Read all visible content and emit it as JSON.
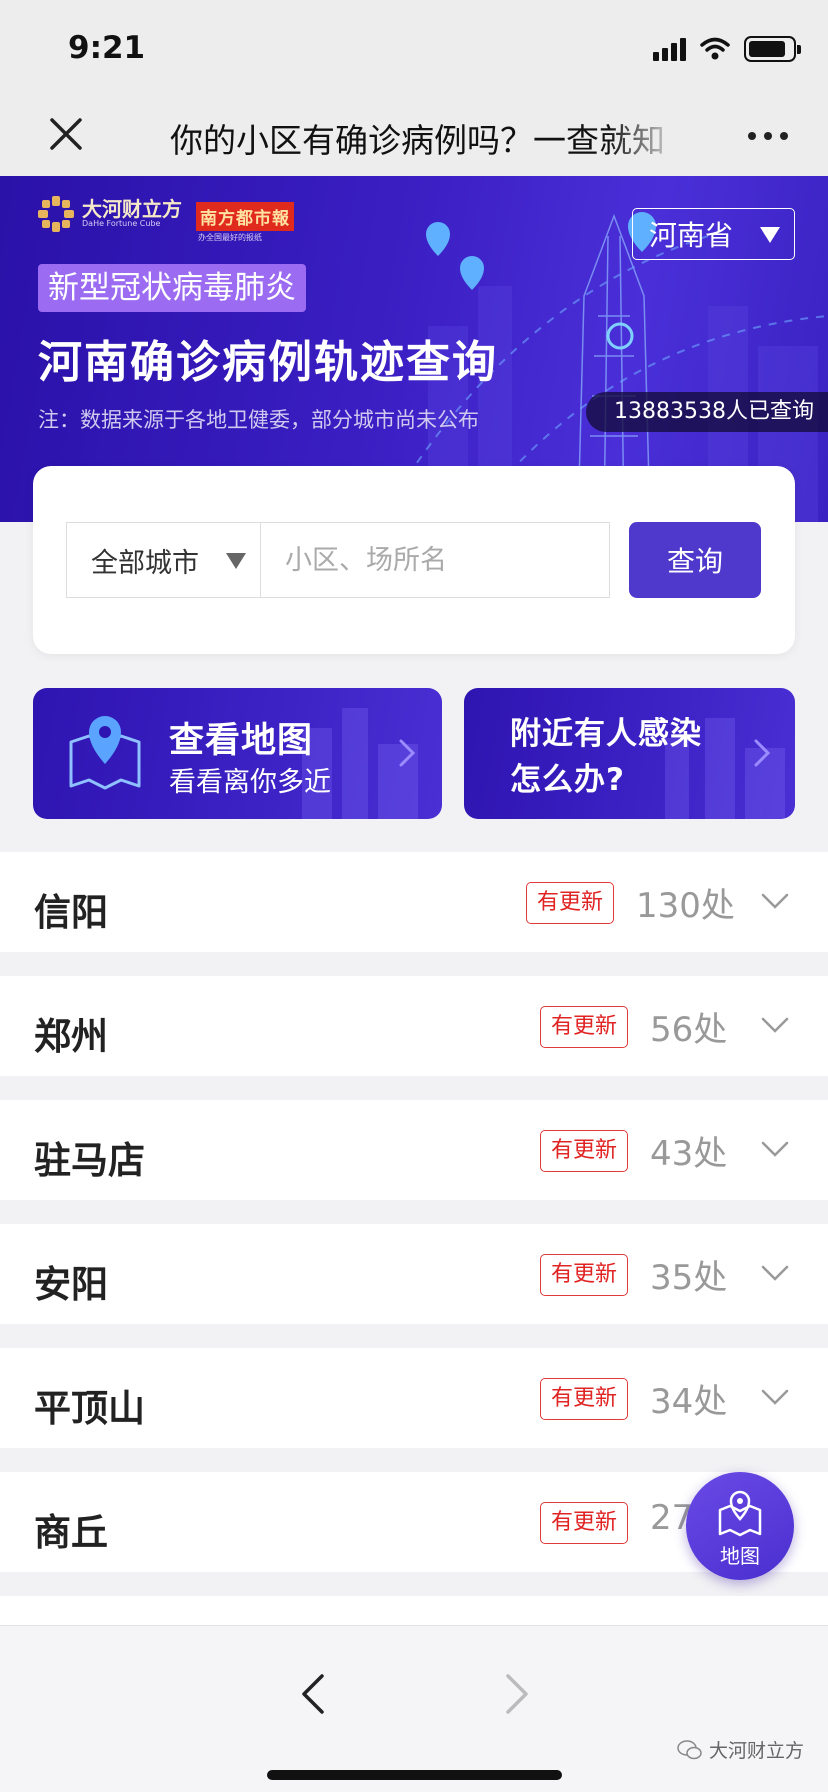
{
  "status_bar": {
    "time": "9:21",
    "battery_level": 0.85
  },
  "nav": {
    "title": "你的小区有确诊病例吗？一查就知"
  },
  "banner": {
    "brand_name": "大河财立方",
    "brand_sub": "DaHe Fortune Cube",
    "paper_name": "南方都市報",
    "paper_sub": "办全国最好的报纸",
    "province": "河南省",
    "tag": "新型冠状病毒肺炎",
    "title": "河南确诊病例轨迹查询",
    "note": "注：数据来源于各地卫健委，部分城市尚未公布",
    "query_count": "13883538人已查询"
  },
  "search": {
    "city_select": "全部城市",
    "placeholder": "小区、场所名",
    "value": "",
    "button": "查询"
  },
  "cards": {
    "map": {
      "title": "查看地图",
      "subtitle": "看看离你多近"
    },
    "help": {
      "line1": "附近有人感染",
      "line2": "怎么办?"
    }
  },
  "cities": [
    {
      "name": "信阳",
      "badge": "有更新",
      "count": "130处"
    },
    {
      "name": "郑州",
      "badge": "有更新",
      "count": "56处"
    },
    {
      "name": "驻马店",
      "badge": "有更新",
      "count": "43处"
    },
    {
      "name": "安阳",
      "badge": "有更新",
      "count": "35处"
    },
    {
      "name": "平顶山",
      "badge": "有更新",
      "count": "34处"
    },
    {
      "name": "商丘",
      "badge": "有更新",
      "count": "27"
    }
  ],
  "float_button": {
    "label": "地图"
  },
  "watermark": "大河财立方",
  "colors": {
    "accent": "#4f38cc",
    "banner": "#3a1ec2",
    "badge_red": "#e02424"
  },
  "icons": [
    "close-icon",
    "more-icon",
    "map-pin-icon",
    "chevron-right-icon",
    "chevron-down-icon",
    "back-icon",
    "forward-icon",
    "wechat-icon"
  ]
}
